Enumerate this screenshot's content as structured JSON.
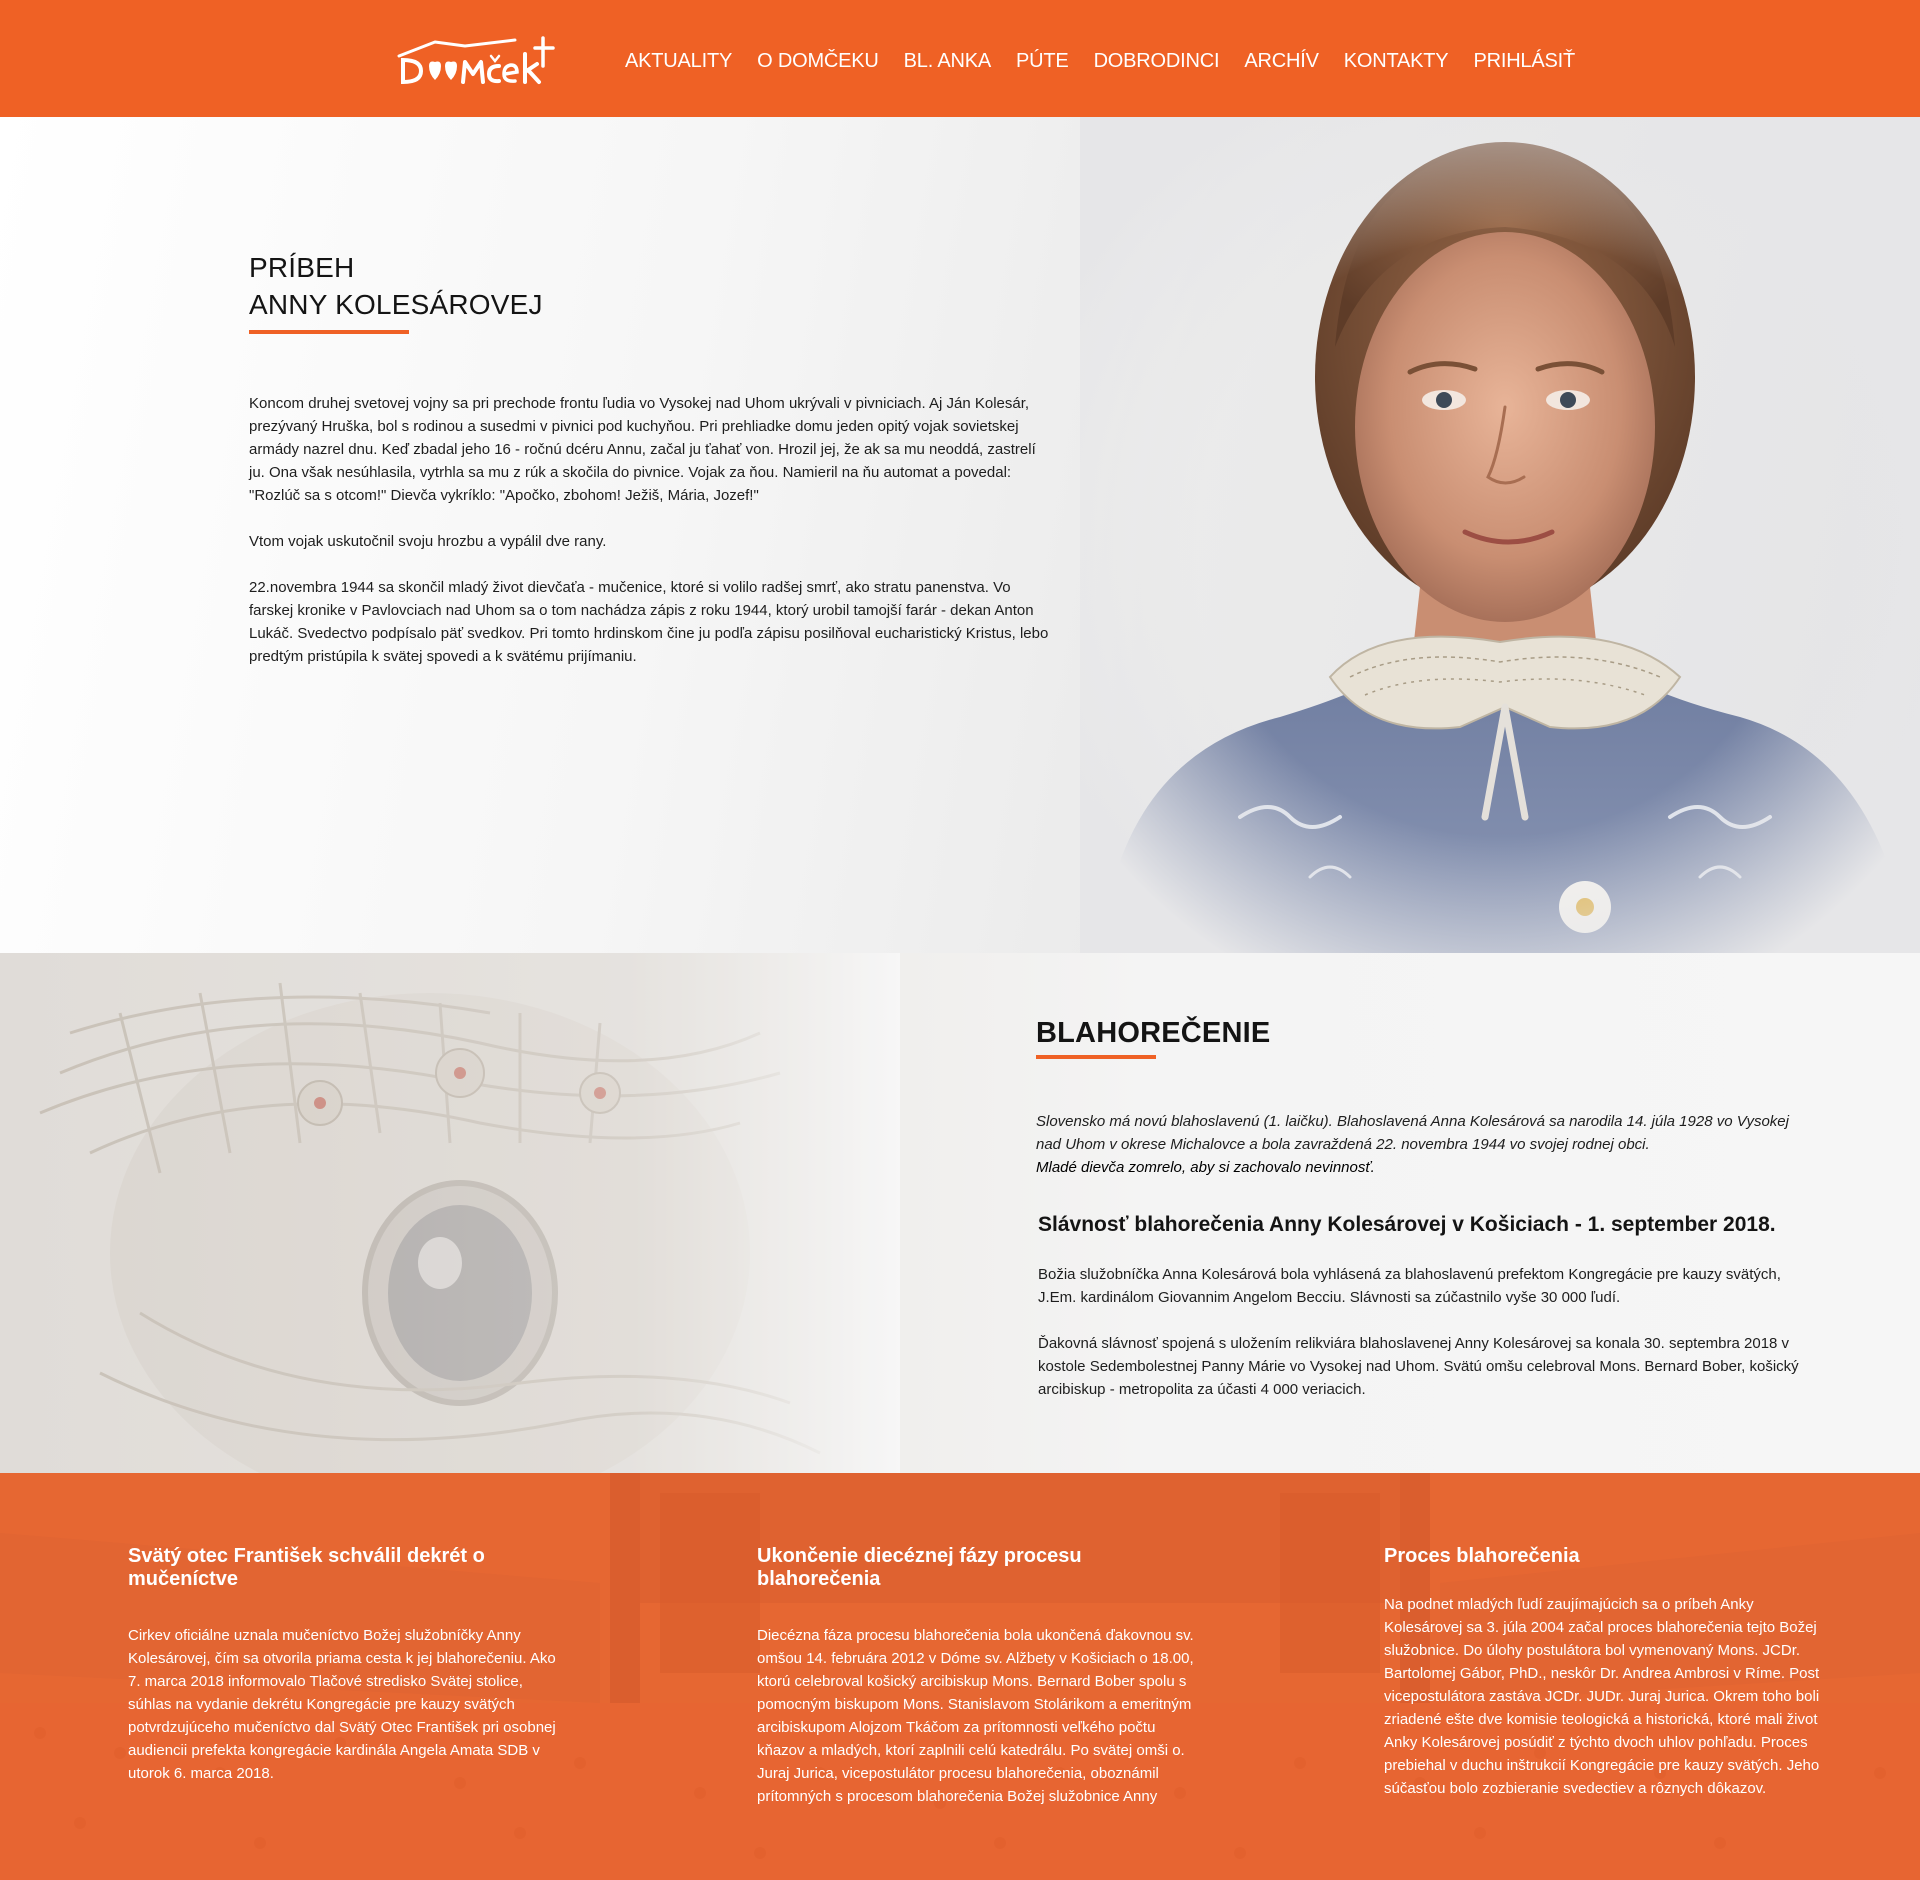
{
  "header": {
    "logo_text": "DOMček",
    "nav": [
      "AKTUALITY",
      "O DOMČEKU",
      "BL. ANKA",
      "PÚTE",
      "DOBRODINCI",
      "ARCHÍV",
      "KONTAKTY",
      "PRIHLÁSIŤ"
    ]
  },
  "colors": {
    "accent": "#ef6125",
    "text": "#1a1a1a",
    "band": "#e26a3a"
  },
  "story": {
    "title_line1": "PRÍBEH",
    "title_line2": "ANNY KOLESÁROVEJ",
    "paragraphs": [
      "Koncom druhej svetovej vojny sa pri prechode frontu ľudia vo Vysokej nad Uhom ukrývali v pivniciach. Aj Ján Kolesár, prezývaný Hruška, bol s rodinou a susedmi v pivnici pod kuchyňou. Pri prehliadke domu jeden opitý vojak sovietskej armády nazrel dnu. Keď zbadal jeho 16 - ročnú dcéru Annu, začal ju ťahať von. Hrozil jej, že ak sa mu neoddá, zastrelí ju. Ona však nesúhlasila, vytrhla sa mu z rúk a skočila do pivnice. Vojak za ňou. Namieril na ňu automat a povedal: \"Rozlúč sa s otcom!\" Dievča vykríklo: \"Apočko, zbohom! Ježiš, Mária, Jozef!\"",
      "Vtom vojak uskutočnil svoju hrozbu a vypálil dve rany.",
      "22.novembra 1944 sa skončil mladý život dievčaťa - mučenice, ktoré si volilo radšej smrť, ako stratu panenstva. Vo farskej kronike v Pavlovciach nad Uhom sa o tom nachádza zápis z roku 1944, ktorý urobil tamojší farár - dekan Anton Lukáč. Svedectvo podpísalo päť svedkov. Pri tomto hrdinskom čine ju podľa zápisu posilňoval eucharistický Kristus, lebo predtým pristúpila k svätej spovedi a k svätému prijímaniu."
    ]
  },
  "blaho": {
    "title": "BLAHOREČENIE",
    "intro": "Slovensko má novú blahoslavenú (1. laičku). Blahoslavená Anna Kolesárová sa narodila 14. júla 1928 vo Vysokej nad Uhom v okrese Michalovce a bola zavraždená 22. novembra 1944 vo svojej rodnej obci.",
    "intro_last": "Mladé dievča zomrelo, aby si zachovalo nevinnosť.",
    "subtitle": "Slávnosť blahorečenia Anny Kolesárovej v Košiciach - 1. september 2018.",
    "paragraphs": [
      "Božia služobníčka Anna Kolesárová bola vyhlásená za blahoslavenú prefektom Kongregácie pre kauzy svätých, J.Em. kardinálom Giovannim Angelom Becciu. Slávnosti sa zúčastnilo vyše 30 000 ľudí.",
      "Ďakovná slávnosť spojená s uložením relikviára blahoslavenej Anny Kolesárovej sa konala 30. septembra 2018 v kostole Sedembolestnej Panny Márie vo Vysokej nad Uhom. Svätú omšu celebroval Mons. Bernard Bober, košický arcibiskup - metropolita za účasti 4 000 veriacich."
    ]
  },
  "columns": [
    {
      "title": "Svätý otec František schválil dekrét o mučeníctve",
      "text": "Cirkev oficiálne uznala mučeníctvo Božej služobníčky Anny Kolesárovej, čím sa otvorila priama cesta k jej blahorečeniu. Ako 7. marca 2018 informovalo Tlačové stredisko Svätej stolice, súhlas na vydanie dekrétu Kongregácie pre kauzy svätých potvrdzujúceho mučeníctvo dal Svätý Otec František pri osobnej audiencii prefekta kongregácie kardinála Angela Amata SDB v utorok 6. marca 2018."
    },
    {
      "title": "Ukončenie diecéznej fázy procesu blahorečenia",
      "text": "Diecézna fáza procesu blahorečenia bola ukončená ďakovnou sv. omšou 14. februára 2012 v Dóme sv. Alžbety v Košiciach o 18.00, ktorú celebroval košický arcibiskup Mons. Bernard Bober spolu s pomocným biskupom Mons. Stanislavom Stolárikom a emeritným arcibiskupom Alojzom Tkáčom za prítomnosti veľkého počtu kňazov a mladých, ktorí zaplnili celú katedrálu. Po svätej omši o. Juraj Jurica, vicepostulátor procesu blahorečenia, oboznámil prítomných s procesom blahorečenia Božej služobnice Anny"
    },
    {
      "title": "Proces blahorečenia",
      "text": "Na podnet mladých ľudí zaujímajúcich sa o príbeh Anky Kolesárovej sa 3. júla 2004 začal proces blahorečenia tejto Božej služobnice. Do úlohy postulátora bol vymenovaný Mons. JCDr. Bartolomej Gábor, PhD., neskôr Dr. Andrea Ambrosi v Ríme. Post vicepostulátora zastáva JCDr. JUDr. Juraj Jurica. Okrem toho boli zriadené ešte dve komisie teologická a historická, ktoré mali život Anky Kolesárovej posúdiť z týchto dvoch uhlov pohľadu.  Proces prebiehal v duchu inštrukcií Kongregácie pre kauzy svätých. Jeho súčasťou bolo zozbieranie svedectiev a rôznych dôkazov."
    }
  ]
}
